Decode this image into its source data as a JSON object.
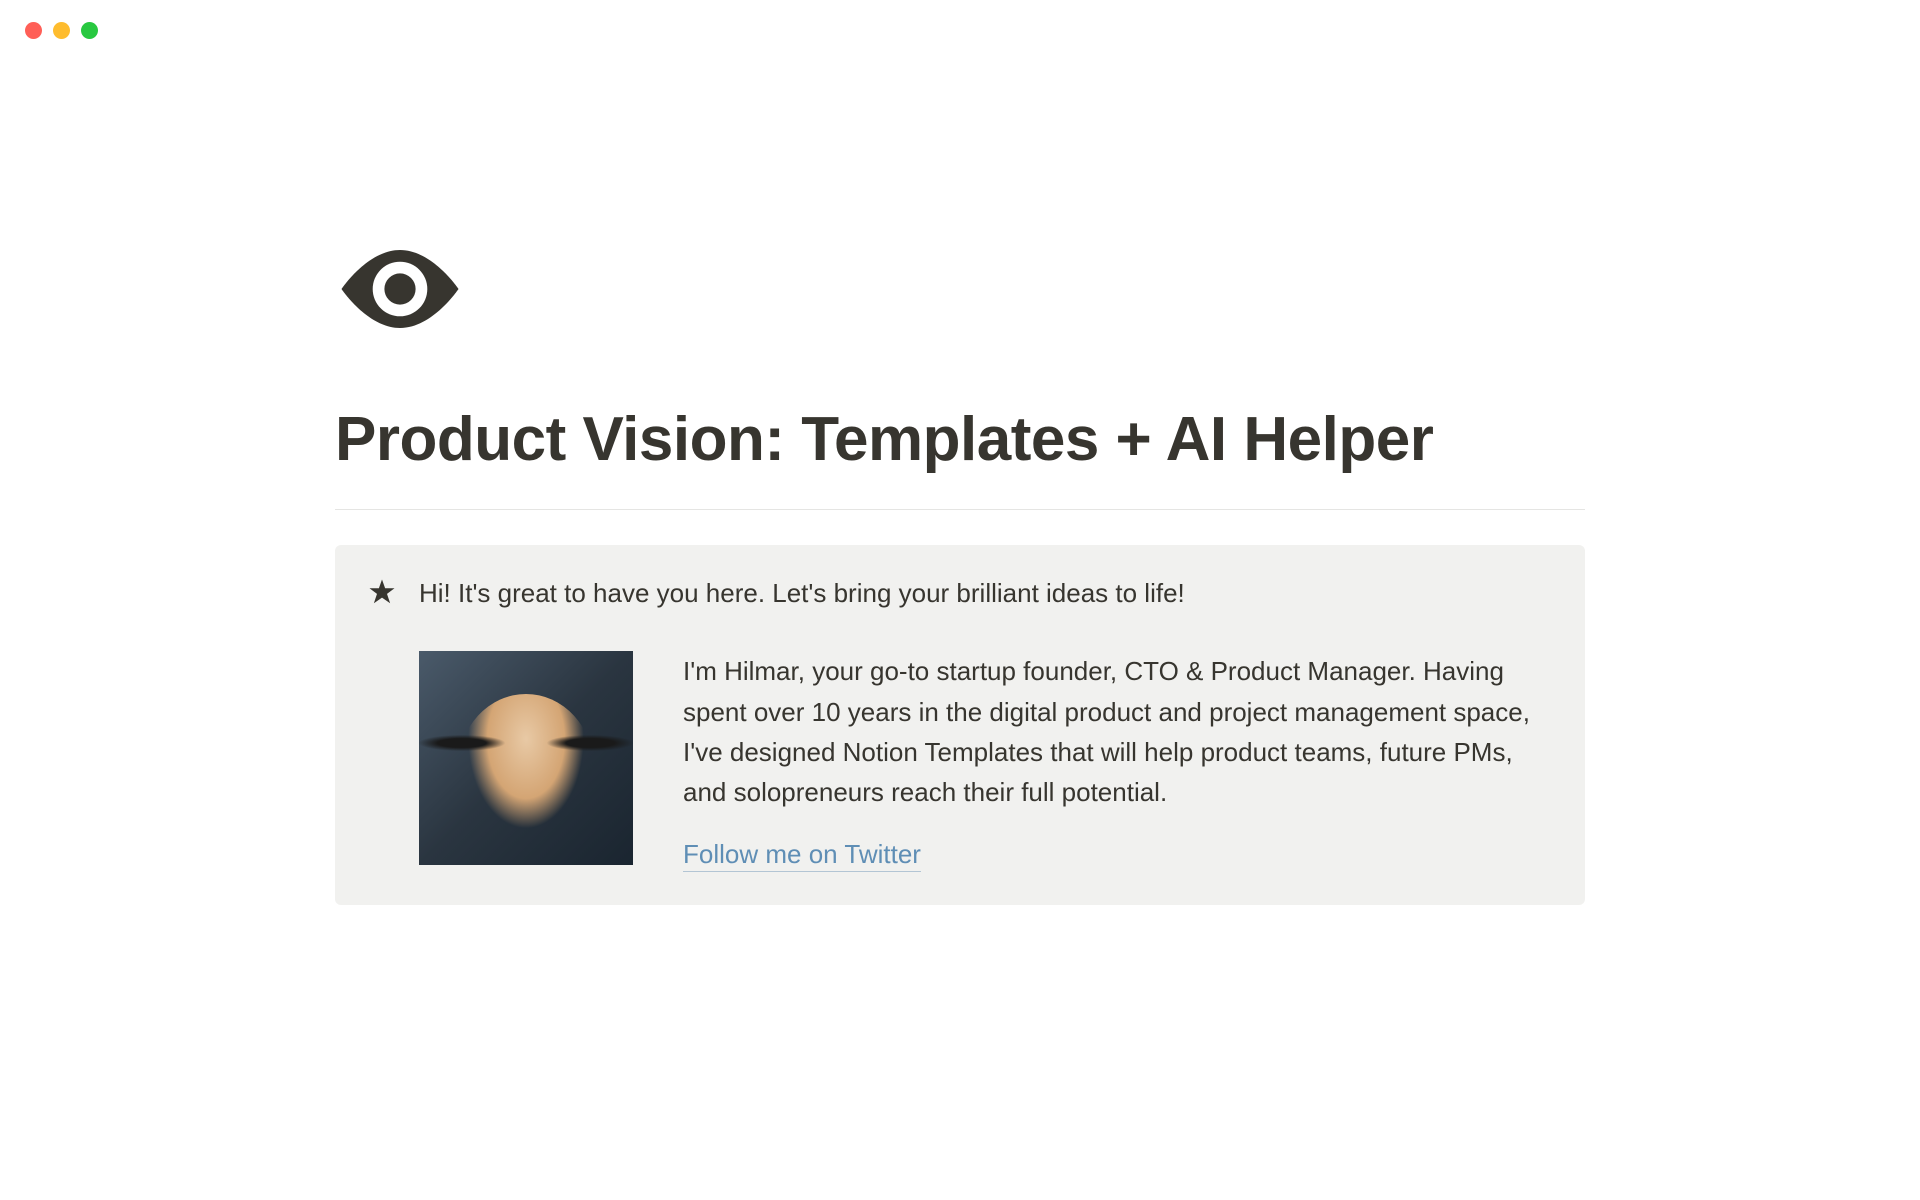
{
  "page": {
    "title": "Product Vision: Templates + AI Helper",
    "icon": "eye-icon"
  },
  "callout": {
    "icon": "star-icon",
    "greeting": "Hi! It's great to have you here. Let's bring your brilliant ideas to life!",
    "bio": "I'm Hilmar, your go-to startup founder, CTO & Product Manager. Having spent over 10 years in the digital product and project management space, I've designed Notion Templates that will help product teams, future PMs, and solopreneurs reach their full potential.",
    "link_text": "Follow me on Twitter"
  }
}
